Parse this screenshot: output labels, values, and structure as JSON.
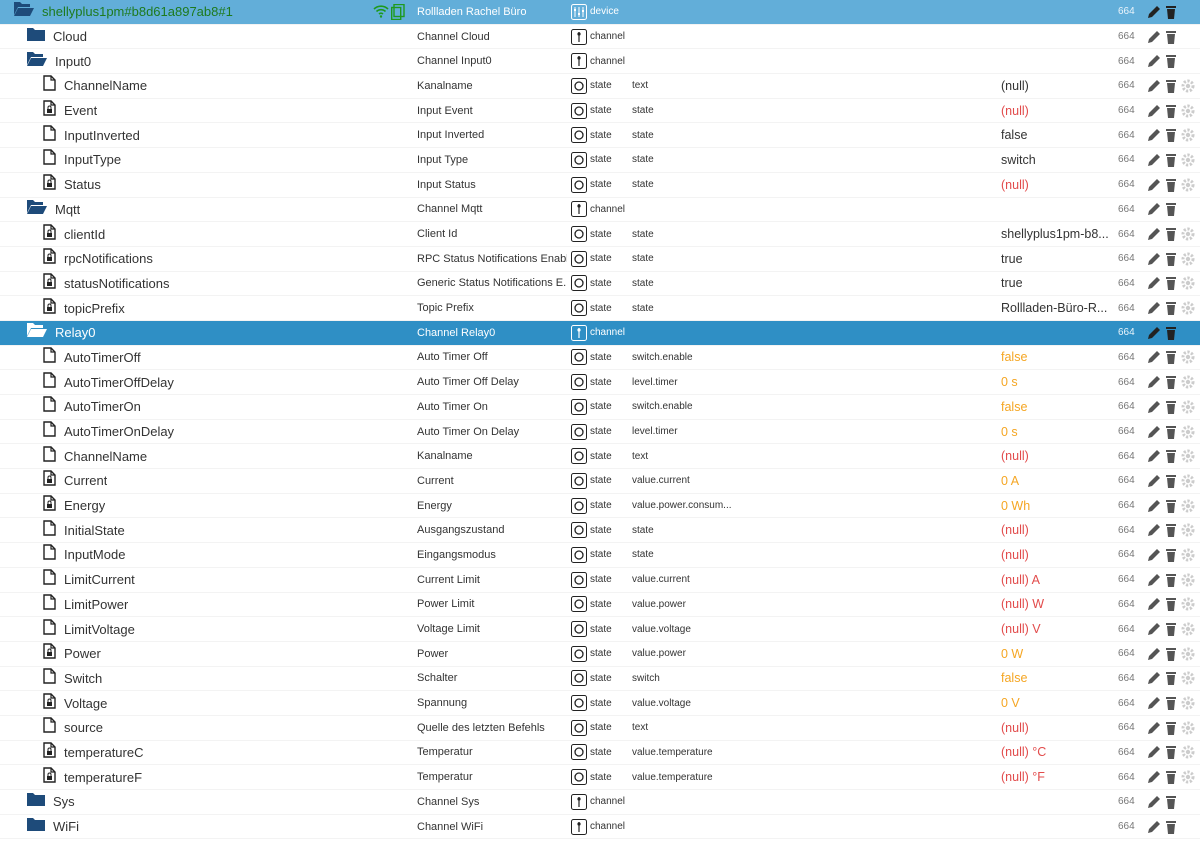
{
  "colors": {
    "selected_row": "#2f8fc5",
    "device_row": "#62aed9",
    "folder": "#1e4b7a",
    "null_value": "#e24b4b",
    "orange_value": "#f5a623",
    "device_label": "#1e7a1e"
  },
  "rows": [
    {
      "level": 0,
      "icon": "folder-open-icon",
      "label": "shellyplus1pm#b8d61a897ab8#1",
      "name": "Rollladen Rachel Büro",
      "type": "device",
      "role": "",
      "value": "",
      "vclass": "",
      "acl": "664",
      "style": "top"
    },
    {
      "level": 1,
      "icon": "folder-icon",
      "label": "Cloud",
      "name": "Channel Cloud",
      "type": "channel",
      "role": "",
      "value": "",
      "vclass": "",
      "acl": "664",
      "style": ""
    },
    {
      "level": 1,
      "icon": "folder-open-icon",
      "label": "Input0",
      "name": "Channel Input0",
      "type": "channel",
      "role": "",
      "value": "",
      "vclass": "",
      "acl": "664",
      "style": ""
    },
    {
      "level": 2,
      "icon": "file-icon",
      "label": "ChannelName",
      "name": "Kanalname",
      "type": "state",
      "role": "text",
      "value": "(null)",
      "vclass": "val-norm",
      "acl": "664",
      "style": ""
    },
    {
      "level": 2,
      "icon": "file-lock-icon",
      "label": "Event",
      "name": "Input Event",
      "type": "state",
      "role": "state",
      "value": "(null)",
      "vclass": "val-null",
      "acl": "664",
      "style": ""
    },
    {
      "level": 2,
      "icon": "file-icon",
      "label": "InputInverted",
      "name": "Input Inverted",
      "type": "state",
      "role": "state",
      "value": "false",
      "vclass": "val-norm",
      "acl": "664",
      "style": ""
    },
    {
      "level": 2,
      "icon": "file-icon",
      "label": "InputType",
      "name": "Input Type",
      "type": "state",
      "role": "state",
      "value": "switch",
      "vclass": "val-norm",
      "acl": "664",
      "style": ""
    },
    {
      "level": 2,
      "icon": "file-lock-icon",
      "label": "Status",
      "name": "Input Status",
      "type": "state",
      "role": "state",
      "value": "(null)",
      "vclass": "val-null",
      "acl": "664",
      "style": ""
    },
    {
      "level": 1,
      "icon": "folder-open-icon",
      "label": "Mqtt",
      "name": "Channel Mqtt",
      "type": "channel",
      "role": "",
      "value": "",
      "vclass": "",
      "acl": "664",
      "style": ""
    },
    {
      "level": 2,
      "icon": "file-lock-icon",
      "label": "clientId",
      "name": "Client Id",
      "type": "state",
      "role": "state",
      "value": "shellyplus1pm-b8...",
      "vclass": "val-norm",
      "acl": "664",
      "style": ""
    },
    {
      "level": 2,
      "icon": "file-lock-icon",
      "label": "rpcNotifications",
      "name": "RPC Status Notifications Enabl...",
      "type": "state",
      "role": "state",
      "value": "true",
      "vclass": "val-norm",
      "acl": "664",
      "style": ""
    },
    {
      "level": 2,
      "icon": "file-lock-icon",
      "label": "statusNotifications",
      "name": "Generic Status Notifications E...",
      "type": "state",
      "role": "state",
      "value": "true",
      "vclass": "val-norm",
      "acl": "664",
      "style": ""
    },
    {
      "level": 2,
      "icon": "file-lock-icon",
      "label": "topicPrefix",
      "name": "Topic Prefix",
      "type": "state",
      "role": "state",
      "value": "Rollladen-Büro-R...",
      "vclass": "val-norm",
      "acl": "664",
      "style": ""
    },
    {
      "level": 1,
      "icon": "folder-open-icon",
      "label": "Relay0",
      "name": "Channel Relay0",
      "type": "channel",
      "role": "",
      "value": "",
      "vclass": "",
      "acl": "664",
      "style": "hl"
    },
    {
      "level": 2,
      "icon": "file-icon",
      "label": "AutoTimerOff",
      "name": "Auto Timer Off",
      "type": "state",
      "role": "switch.enable",
      "value": "false",
      "vclass": "val-orange",
      "acl": "664",
      "style": ""
    },
    {
      "level": 2,
      "icon": "file-icon",
      "label": "AutoTimerOffDelay",
      "name": "Auto Timer Off Delay",
      "type": "state",
      "role": "level.timer",
      "value": "0 s",
      "vclass": "val-orange",
      "acl": "664",
      "style": ""
    },
    {
      "level": 2,
      "icon": "file-icon",
      "label": "AutoTimerOn",
      "name": "Auto Timer On",
      "type": "state",
      "role": "switch.enable",
      "value": "false",
      "vclass": "val-orange",
      "acl": "664",
      "style": ""
    },
    {
      "level": 2,
      "icon": "file-icon",
      "label": "AutoTimerOnDelay",
      "name": "Auto Timer On Delay",
      "type": "state",
      "role": "level.timer",
      "value": "0 s",
      "vclass": "val-orange",
      "acl": "664",
      "style": ""
    },
    {
      "level": 2,
      "icon": "file-icon",
      "label": "ChannelName",
      "name": "Kanalname",
      "type": "state",
      "role": "text",
      "value": "(null)",
      "vclass": "val-null",
      "acl": "664",
      "style": ""
    },
    {
      "level": 2,
      "icon": "file-lock-icon",
      "label": "Current",
      "name": "Current",
      "type": "state",
      "role": "value.current",
      "value": "0 A",
      "vclass": "val-orange",
      "acl": "664",
      "style": ""
    },
    {
      "level": 2,
      "icon": "file-lock-icon",
      "label": "Energy",
      "name": "Energy",
      "type": "state",
      "role": "value.power.consum...",
      "value": "0 Wh",
      "vclass": "val-orange",
      "acl": "664",
      "style": ""
    },
    {
      "level": 2,
      "icon": "file-icon",
      "label": "InitialState",
      "name": "Ausgangszustand",
      "type": "state",
      "role": "state",
      "value": "(null)",
      "vclass": "val-null",
      "acl": "664",
      "style": ""
    },
    {
      "level": 2,
      "icon": "file-icon",
      "label": "InputMode",
      "name": "Eingangsmodus",
      "type": "state",
      "role": "state",
      "value": "(null)",
      "vclass": "val-null",
      "acl": "664",
      "style": ""
    },
    {
      "level": 2,
      "icon": "file-icon",
      "label": "LimitCurrent",
      "name": "Current Limit",
      "type": "state",
      "role": "value.current",
      "value": "(null) A",
      "vclass": "val-null",
      "acl": "664",
      "style": ""
    },
    {
      "level": 2,
      "icon": "file-icon",
      "label": "LimitPower",
      "name": "Power Limit",
      "type": "state",
      "role": "value.power",
      "value": "(null) W",
      "vclass": "val-null",
      "acl": "664",
      "style": ""
    },
    {
      "level": 2,
      "icon": "file-icon",
      "label": "LimitVoltage",
      "name": "Voltage Limit",
      "type": "state",
      "role": "value.voltage",
      "value": "(null) V",
      "vclass": "val-null",
      "acl": "664",
      "style": ""
    },
    {
      "level": 2,
      "icon": "file-lock-icon",
      "label": "Power",
      "name": "Power",
      "type": "state",
      "role": "value.power",
      "value": "0 W",
      "vclass": "val-orange",
      "acl": "664",
      "style": ""
    },
    {
      "level": 2,
      "icon": "file-icon",
      "label": "Switch",
      "name": "Schalter",
      "type": "state",
      "role": "switch",
      "value": "false",
      "vclass": "val-orange",
      "acl": "664",
      "style": ""
    },
    {
      "level": 2,
      "icon": "file-lock-icon",
      "label": "Voltage",
      "name": "Spannung",
      "type": "state",
      "role": "value.voltage",
      "value": "0 V",
      "vclass": "val-orange",
      "acl": "664",
      "style": ""
    },
    {
      "level": 2,
      "icon": "file-icon",
      "label": "source",
      "name": "Quelle des letzten Befehls",
      "type": "state",
      "role": "text",
      "value": "(null)",
      "vclass": "val-null",
      "acl": "664",
      "style": ""
    },
    {
      "level": 2,
      "icon": "file-lock-icon",
      "label": "temperatureC",
      "name": "Temperatur",
      "type": "state",
      "role": "value.temperature",
      "value": "(null) °C",
      "vclass": "val-null",
      "acl": "664",
      "style": ""
    },
    {
      "level": 2,
      "icon": "file-lock-icon",
      "label": "temperatureF",
      "name": "Temperatur",
      "type": "state",
      "role": "value.temperature",
      "value": "(null) °F",
      "vclass": "val-null",
      "acl": "664",
      "style": ""
    },
    {
      "level": 1,
      "icon": "folder-icon",
      "label": "Sys",
      "name": "Channel Sys",
      "type": "channel",
      "role": "",
      "value": "",
      "vclass": "",
      "acl": "664",
      "style": ""
    },
    {
      "level": 1,
      "icon": "folder-icon",
      "label": "WiFi",
      "name": "Channel WiFi",
      "type": "channel",
      "role": "",
      "value": "",
      "vclass": "",
      "acl": "664",
      "style": ""
    }
  ]
}
